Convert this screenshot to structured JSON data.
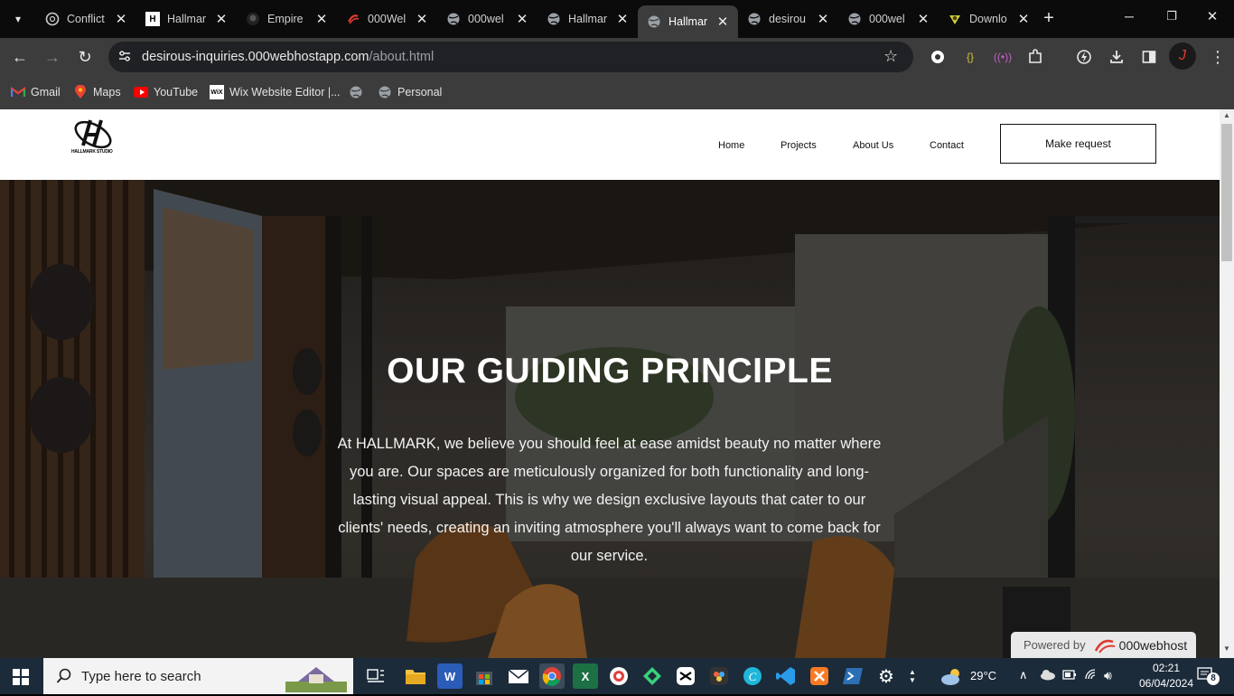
{
  "browser": {
    "tabs": [
      {
        "label": "Conflict",
        "icon": "chatgpt-icon"
      },
      {
        "label": "Hallmar",
        "icon": "hallmark-logo-icon"
      },
      {
        "label": "Empire",
        "icon": "github-icon"
      },
      {
        "label": "000Wel",
        "icon": "000webhost-icon"
      },
      {
        "label": "000wel",
        "icon": "globe-icon"
      },
      {
        "label": "Hallmar",
        "icon": "globe-icon"
      },
      {
        "label": "Hallmar",
        "icon": "globe-icon",
        "active": true
      },
      {
        "label": "desirou",
        "icon": "globe-icon"
      },
      {
        "label": "000wel",
        "icon": "globe-icon"
      },
      {
        "label": "Downlo",
        "icon": "download-site-icon"
      }
    ],
    "url_host": "desirous-inquiries.000webhostapp.com",
    "url_path": "/about.html",
    "bookmarks": [
      {
        "label": "Gmail",
        "icon": "gmail-icon"
      },
      {
        "label": "Maps",
        "icon": "maps-icon"
      },
      {
        "label": "YouTube",
        "icon": "youtube-icon"
      },
      {
        "label": "Wix Website Editor |...",
        "icon": "wix-icon"
      },
      {
        "label": "",
        "icon": "globe-icon"
      },
      {
        "label": "Personal",
        "icon": "globe-icon"
      }
    ]
  },
  "site": {
    "logo_text": "HALLMARK STUDIO",
    "nav": [
      "Home",
      "Projects",
      "About Us",
      "Contact"
    ],
    "cta": "Make request",
    "hero_title": "OUR GUIDING PRINCIPLE",
    "hero_text": "At HALLMARK, we believe you should feel at ease amidst beauty no matter where you are. Our spaces are meticulously organized for both functionality and long-lasting visual appeal. This is why we design exclusive layouts that cater to our clients' needs, creating an inviting atmosphere you'll always want to come back for our service.",
    "powered_by_label": "Powered by",
    "powered_by_brand": "000webhost"
  },
  "taskbar": {
    "search_placeholder": "Type here to search",
    "weather": "29°C",
    "time": "02:21",
    "date": "06/04/2024",
    "notifications": "8"
  },
  "colors": {
    "tabstrip": "#0b0b0b",
    "toolbar": "#3c3c3c",
    "taskbar": "#1c2b3a",
    "accent_red": "#e03a2e"
  }
}
